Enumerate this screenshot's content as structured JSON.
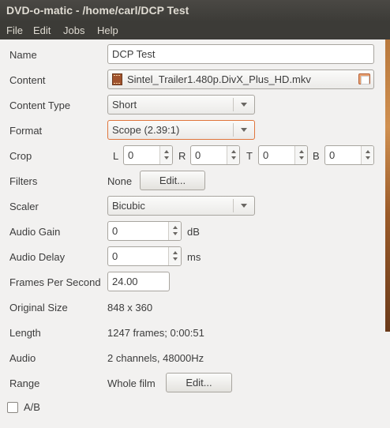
{
  "window": {
    "title": "DVD-o-matic - /home/carl/DCP Test"
  },
  "menu": {
    "file": "File",
    "edit": "Edit",
    "jobs": "Jobs",
    "help": "Help"
  },
  "form": {
    "name": {
      "label": "Name",
      "value": "DCP Test"
    },
    "content": {
      "label": "Content",
      "value": "Sintel_Trailer1.480p.DivX_Plus_HD.mkv",
      "file_icon": "film-file-icon",
      "folder_icon": "folder-open-icon"
    },
    "content_type": {
      "label": "Content Type",
      "value": "Short"
    },
    "format": {
      "label": "Format",
      "value": "Scope (2.39:1)"
    },
    "crop": {
      "label": "Crop",
      "l_label": "L",
      "l": "0",
      "r_label": "R",
      "r": "0",
      "t_label": "T",
      "t": "0",
      "b_label": "B",
      "b": "0"
    },
    "filters": {
      "label": "Filters",
      "value": "None",
      "button": "Edit..."
    },
    "scaler": {
      "label": "Scaler",
      "value": "Bicubic"
    },
    "audio_gain": {
      "label": "Audio Gain",
      "value": "0",
      "unit": "dB"
    },
    "audio_delay": {
      "label": "Audio Delay",
      "value": "0",
      "unit": "ms"
    },
    "fps": {
      "label": "Frames Per Second",
      "value": "24.00"
    },
    "original_size": {
      "label": "Original Size",
      "value": "848 x 360"
    },
    "length": {
      "label": "Length",
      "value": "1247 frames; 0:00:51"
    },
    "audio": {
      "label": "Audio",
      "value": "2 channels, 48000Hz"
    },
    "range": {
      "label": "Range",
      "value": "Whole film",
      "button": "Edit..."
    },
    "ab": {
      "label": "A/B",
      "checked": false
    }
  }
}
